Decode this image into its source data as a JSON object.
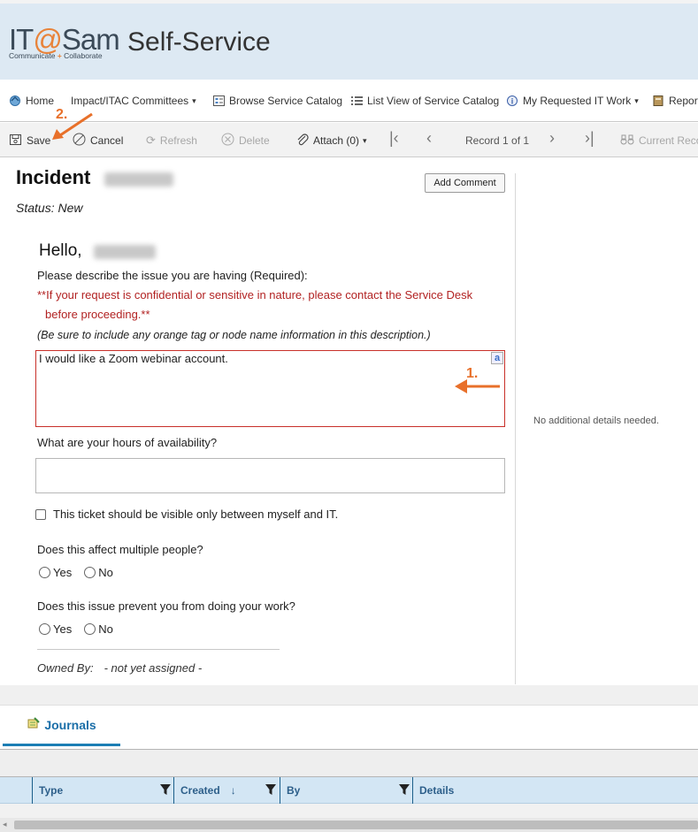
{
  "header": {
    "logo_main_1": "IT",
    "logo_at": "@",
    "logo_main_2": "Sam",
    "logo_sub_1": "Communicate ",
    "logo_plus": "+",
    "logo_sub_2": " Collaborate",
    "app_title": "Self-Service"
  },
  "nav": {
    "items": [
      {
        "label": "Home",
        "icon": "home-icon"
      },
      {
        "label": "Impact/ITAC Committees",
        "icon": "",
        "caret": "▾"
      },
      {
        "label": "Browse Service Catalog",
        "icon": "catalog-icon"
      },
      {
        "label": "List View of Service Catalog",
        "icon": "list-icon"
      },
      {
        "label": "My Requested IT Work",
        "icon": "help-icon",
        "caret": "▾"
      },
      {
        "label": "Report",
        "icon": "report-icon"
      }
    ]
  },
  "toolbar": {
    "save": "Save",
    "cancel": "Cancel",
    "refresh": "Refresh",
    "delete": "Delete",
    "attach": "Attach (0)",
    "record": "Record 1 of 1",
    "current_record": "Current Reco"
  },
  "annotations": {
    "step1": "1.",
    "step2": "2.",
    "accent": "#e8702a"
  },
  "incident": {
    "title": "Incident",
    "status": "Status: New",
    "add_comment": "Add Comment"
  },
  "form": {
    "hello": "Hello,",
    "describe_label": "Please describe the issue you are having (Required):",
    "warning": "**If your request is confidential or sensitive in nature, please contact the Service Desk",
    "warning_2": "before proceeding.**",
    "hint": "(Be sure to include any orange tag or node name information in this description.)",
    "description_value": "I would like a Zoom webinar account.",
    "hours_label": "What are your hours of availability?",
    "hours_value": "",
    "visibility_label": "This ticket should be visible only between myself and IT.",
    "multiple_label": "Does this affect multiple people?",
    "prevent_label": "Does this issue prevent you from doing your work?",
    "yes": "Yes",
    "no": "No",
    "owned_label": "Owned By:",
    "owned_value": "- not yet assigned -"
  },
  "side": {
    "note": "No additional details needed."
  },
  "journals": {
    "tab": "Journals",
    "columns": [
      "Type",
      "Created",
      "By",
      "Details"
    ],
    "sort_glyph": "↓"
  },
  "colors": {
    "header_bg": "#dde9f3",
    "brand_orange": "#e8833a",
    "required_border": "#c8302a",
    "warning_text": "#b22222",
    "tab_accent": "#1b7eb4",
    "grid_header_bg": "#d3e6f4"
  }
}
